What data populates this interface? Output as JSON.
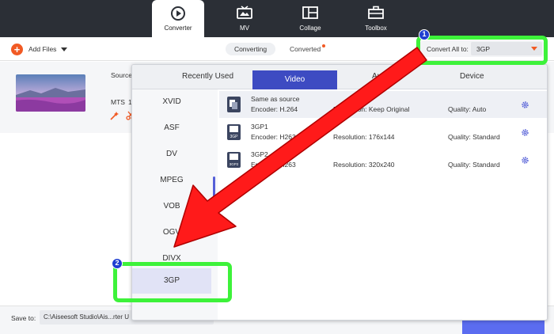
{
  "nav": {
    "tabs": [
      {
        "label": "Converter",
        "icon": "converter-icon",
        "active": true
      },
      {
        "label": "MV",
        "icon": "tv-icon"
      },
      {
        "label": "Collage",
        "icon": "collage-icon"
      },
      {
        "label": "Toolbox",
        "icon": "toolbox-icon"
      }
    ]
  },
  "toolbar": {
    "add_files": "Add Files",
    "converting": "Converting",
    "converted": "Converted"
  },
  "convert_all": {
    "label": "Convert All to:",
    "value": "3GP"
  },
  "file": {
    "source_label": "Source",
    "format": "MTS",
    "extra": "1"
  },
  "panel": {
    "tabs": [
      "Recently Used",
      "Video",
      "Audio",
      "Device"
    ],
    "active_tab": "Video",
    "formats": [
      "XVID",
      "ASF",
      "DV",
      "MPEG",
      "VOB",
      "OGV",
      "DIVX",
      "3GP"
    ],
    "selected_format": "3GP",
    "presets": [
      {
        "name": "Same as source",
        "encoder": "Encoder: H.264",
        "resolution": "Resolution: Keep Original",
        "quality": "Quality: Auto"
      },
      {
        "name": "3GP1",
        "encoder": "Encoder: H263",
        "resolution": "Resolution: 176x144",
        "quality": "Quality: Standard"
      },
      {
        "name": "3GP2",
        "encoder": "Encoder: H263",
        "resolution": "Resolution: 320x240",
        "quality": "Quality: Standard"
      }
    ]
  },
  "bottom": {
    "save_label": "Save to:",
    "save_path": "C:\\Aiseesoft Studio\\Ais...rter U"
  },
  "annotations": {
    "badge1": "1",
    "badge2": "2",
    "highlight_color": "#3df23a",
    "arrow_color": "#ff1a1a"
  }
}
